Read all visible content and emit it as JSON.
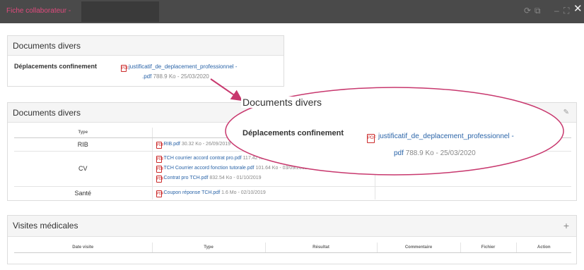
{
  "window": {
    "title": "Fiche collaborateur -",
    "controls": [
      "refresh-icon",
      "external-link-icon",
      "minimize-icon",
      "maximize-icon",
      "close-icon"
    ],
    "minimize_glyph": "–",
    "close_glyph": "✕"
  },
  "panel_top": {
    "title": "Documents divers",
    "field_label": "Déplacements confinement",
    "file_name_1": "justificatif_de_deplacement_professionnel -",
    "file_name_2": ".pdf",
    "file_meta": "788.9 Ko - 25/03/2020"
  },
  "panel_docs": {
    "title": "Documents divers",
    "columns": [
      "Type",
      "",
      ""
    ],
    "rows": [
      {
        "type": "RIB",
        "files": [
          {
            "name": "RIB.pdf",
            "meta": "30.32 Ko - 26/09/2019"
          }
        ]
      },
      {
        "type": "CV",
        "files": [
          {
            "name": "TCH courrier accord contrat pro.pdf",
            "meta": "117.42 Ko"
          },
          {
            "name": "TCH Courrier accord fonction tutorale.pdf",
            "meta": "101.64 Ko - 03/09/2019"
          },
          {
            "name": "Contrat pro TCH.pdf",
            "meta": "832.54 Ko - 01/10/2019"
          }
        ]
      },
      {
        "type": "Santé",
        "files": [
          {
            "name": "Coupon réponse TCH.pdf",
            "meta": "1.6 Mo - 02/10/2019"
          }
        ]
      }
    ]
  },
  "panel_visits": {
    "title": "Visites médicales",
    "columns": [
      "Date visite",
      "Type",
      "Résultat",
      "Commentaire",
      "Fichier",
      "Action"
    ]
  },
  "zoom_callout": {
    "title": "Documents divers",
    "field_label": "Déplacements confinement",
    "file_name_1": "justificatif_de_deplacement_professionnel -",
    "file_name_2": "pdf",
    "file_meta": "788.9 Ko - 25/03/2020"
  },
  "colors": {
    "titlebar_bg": "#4a4a4a",
    "title_accent": "#e04a7d",
    "link": "#2a64a8",
    "pdf_red": "#cc2b2b",
    "annotation": "#c8386e"
  }
}
